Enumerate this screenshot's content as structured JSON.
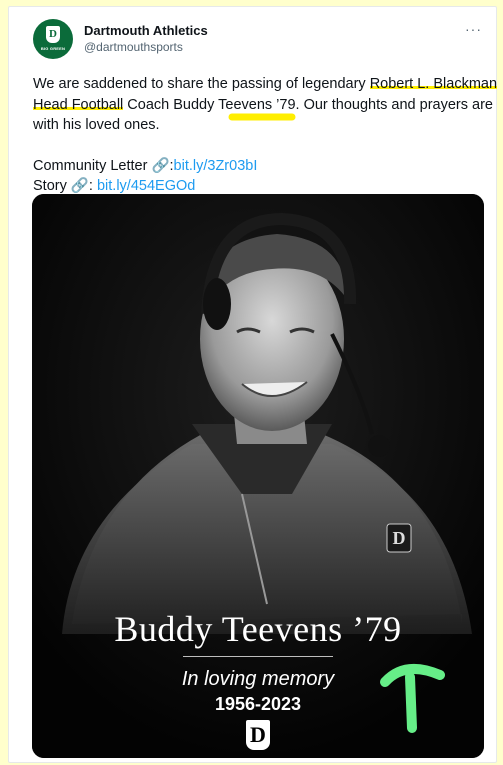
{
  "tweet": {
    "author_name": "Dartmouth Athletics",
    "author_handle": "@dartmouthsports",
    "avatar_text": "BIG GREEN",
    "avatar_letter": "D",
    "more_label": "···",
    "body": {
      "line1_pre": "We are saddened to share the passing of legendary ",
      "line1_hl": "Robert L. Blackman",
      "line2_hl1": "Head Football",
      "line2_mid": " Coach Buddy Teevens ’79. Our thoughts and prayers are",
      "line3": "with his loved ones."
    },
    "community_label": "Community Letter 🔗:",
    "community_link": "bit.ly/3Zr03bI",
    "story_label": "Story 🔗: ",
    "story_link": "bit.ly/454EGOd"
  },
  "media": {
    "name": "Buddy Teevens ’79",
    "memory": "In loving memory",
    "years": "1956-2023",
    "logo_letter": "D"
  },
  "colors": {
    "background": "#ffffcc",
    "highlight": "#ffee00",
    "arrow": "#66ee88",
    "link": "#1d9bf0",
    "avatar": "#0b6b3a"
  }
}
